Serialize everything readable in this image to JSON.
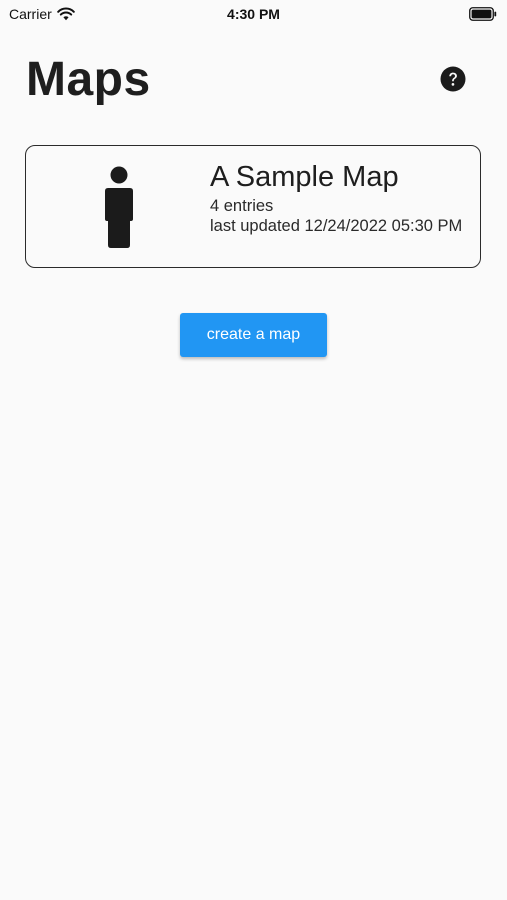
{
  "status_bar": {
    "carrier": "Carrier",
    "time": "4:30 PM",
    "wifi_icon": "wifi-icon",
    "battery_icon": "battery-full-icon"
  },
  "header": {
    "title": "Maps",
    "help_icon": "help-circle-icon"
  },
  "maps": [
    {
      "icon": "person-icon",
      "name": "A Sample Map",
      "entries": "4 entries",
      "last_updated": "last updated 12/24/2022 05:30 PM"
    }
  ],
  "actions": {
    "create_label": "create a map"
  },
  "colors": {
    "background": "#fafafa",
    "accent": "#2196f3",
    "text": "#1e1e1e"
  }
}
